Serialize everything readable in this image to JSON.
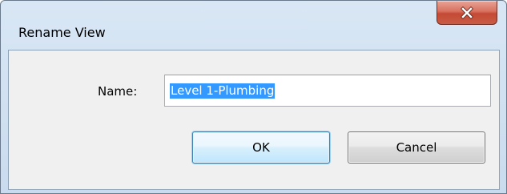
{
  "window": {
    "title": "Rename View",
    "close_icon": "close-icon"
  },
  "form": {
    "name_label": "Name:",
    "name_value": "Level 1-Plumbing"
  },
  "buttons": {
    "ok_label": "OK",
    "cancel_label": "Cancel"
  },
  "colors": {
    "selection_highlight": "#3399ff",
    "close_button": "#c44a35"
  }
}
